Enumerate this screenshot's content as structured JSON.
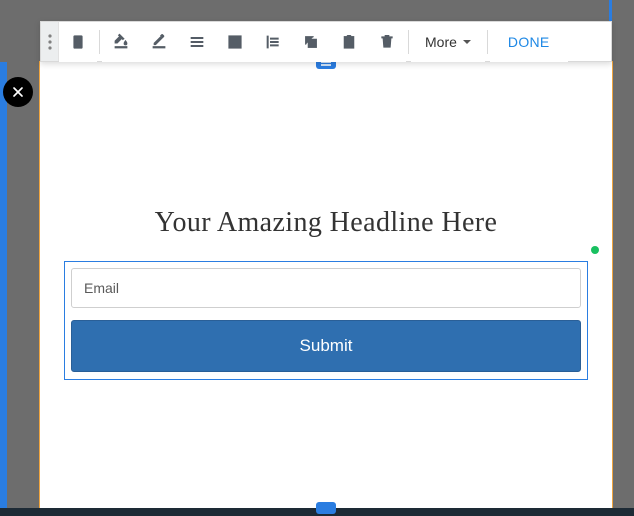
{
  "toolbar": {
    "more_label": "More",
    "done_label": "DONE"
  },
  "canvas": {
    "headline": "Your Amazing Headline Here"
  },
  "form": {
    "email_placeholder": "Email",
    "submit_label": "Submit"
  }
}
